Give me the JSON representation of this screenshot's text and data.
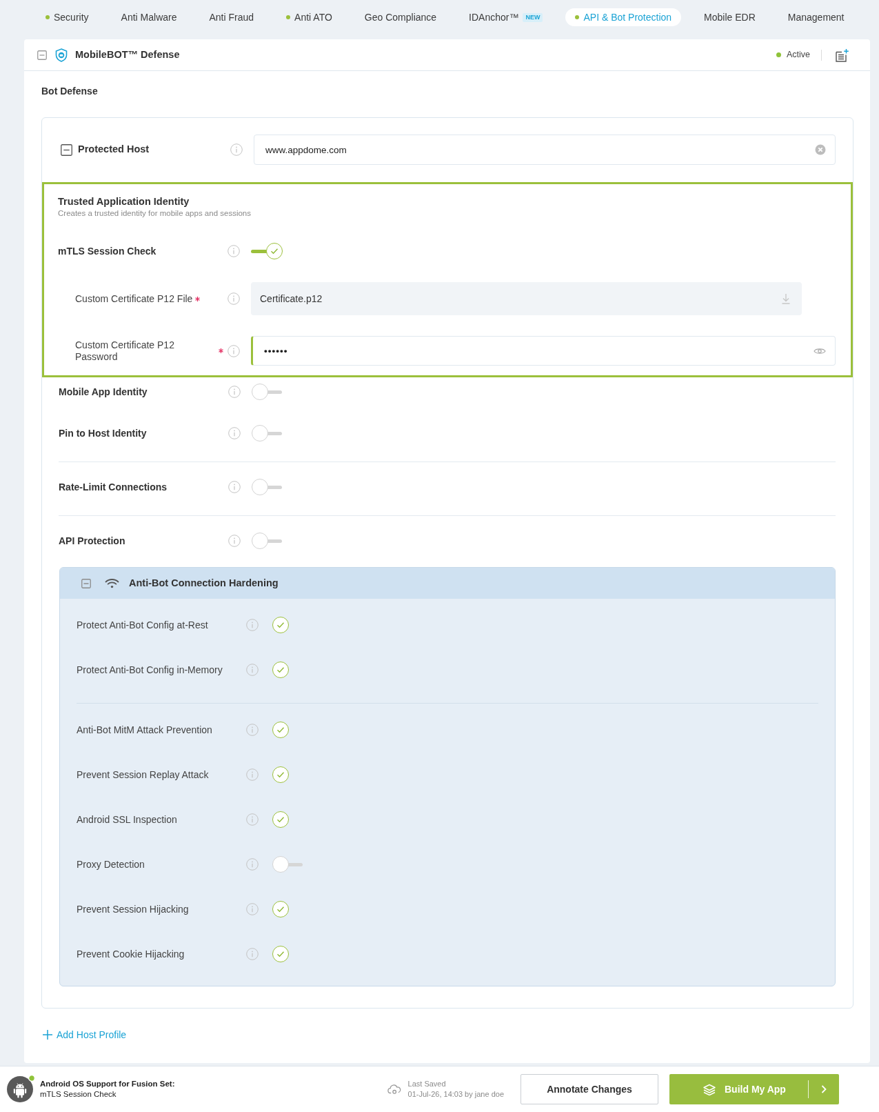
{
  "nav_tabs": [
    {
      "label": "Security",
      "enabled": true,
      "selected": false
    },
    {
      "label": "Anti Malware",
      "enabled": false,
      "selected": false
    },
    {
      "label": "Anti Fraud",
      "enabled": false,
      "selected": false
    },
    {
      "label": "Anti ATO",
      "enabled": true,
      "selected": false
    },
    {
      "label": "Geo Compliance",
      "enabled": false,
      "selected": false
    },
    {
      "label": "IDAnchor™",
      "badge": "NEW",
      "enabled": false,
      "selected": false
    },
    {
      "label": "API & Bot Protection",
      "enabled": true,
      "selected": true
    },
    {
      "label": "Mobile EDR",
      "enabled": false,
      "selected": false
    },
    {
      "label": "Management",
      "enabled": false,
      "selected": false
    }
  ],
  "panel": {
    "title": "MobileBOT™ Defense",
    "expanded": true,
    "status": "Active"
  },
  "section_title": "Bot Defense",
  "host_profile": {
    "label": "Protected Host",
    "expanded": true,
    "host": "www.appdome.com",
    "identity": {
      "title": "Trusted Application Identity",
      "subtitle": "Creates a trusted identity for mobile apps and sessions",
      "highlighted": true,
      "settings": [
        {
          "kind": "toggle",
          "label": "mTLS Session Check",
          "on": true
        },
        {
          "kind": "file",
          "label": "Custom Certificate P12 File",
          "required": true,
          "value": "Certificate.p12"
        },
        {
          "kind": "password",
          "label": "Custom Certificate P12 Password",
          "required": true,
          "focused": true,
          "value": "••••••"
        }
      ]
    },
    "setting_groups": [
      {
        "settings": [
          {
            "label": "Mobile App Identity",
            "on": false
          },
          {
            "label": "Pin to Host Identity",
            "on": false
          }
        ]
      },
      {
        "settings": [
          {
            "label": "Rate-Limit Connections",
            "on": false
          }
        ]
      },
      {
        "settings": [
          {
            "label": "API Protection",
            "on": false
          }
        ]
      }
    ],
    "hardening": {
      "title": "Anti-Bot Connection Hardening",
      "expanded": true,
      "groups": [
        {
          "items": [
            {
              "label": "Protect Anti-Bot Config at-Rest",
              "on": true
            },
            {
              "label": "Protect Anti-Bot Config in-Memory",
              "on": true
            }
          ]
        },
        {
          "items": [
            {
              "label": "Anti-Bot MitM Attack Prevention",
              "on": true
            },
            {
              "label": "Prevent Session Replay Attack",
              "on": true
            },
            {
              "label": "Android SSL Inspection",
              "on": true
            },
            {
              "label": "Proxy Detection",
              "on": false
            },
            {
              "label": "Prevent Session Hijacking",
              "on": true
            },
            {
              "label": "Prevent Cookie Hijacking",
              "on": true
            }
          ]
        }
      ]
    }
  },
  "add_host_profile": "Add Host Profile",
  "footer": {
    "platform_title": "Android OS Support for Fusion Set:",
    "platform_detail": "mTLS Session Check",
    "platform_connected": true,
    "saved_label": "Last Saved",
    "saved_detail": "01-Jul-26, 14:03 by jane doe",
    "buttons": [
      {
        "label": "Annotate Changes",
        "kind": "secondary"
      },
      {
        "label": "Build My App",
        "kind": "primary"
      }
    ]
  }
}
